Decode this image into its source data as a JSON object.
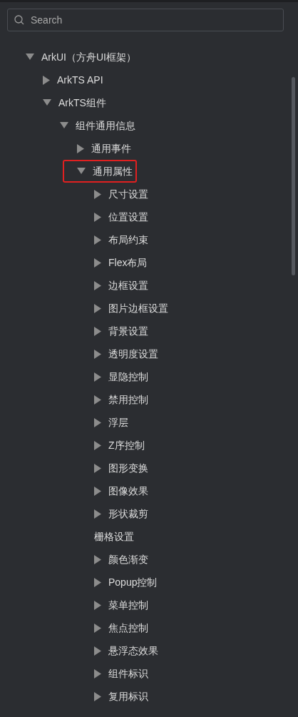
{
  "search": {
    "placeholder": "Search"
  },
  "tree": [
    {
      "label": "ArkUI（方舟UI框架）",
      "expanded": true,
      "children": [
        {
          "label": "ArkTS API",
          "expanded": false
        },
        {
          "label": "ArkTS组件",
          "expanded": true,
          "children": [
            {
              "label": "组件通用信息",
              "expanded": true,
              "children": [
                {
                  "label": "通用事件",
                  "expanded": false
                },
                {
                  "label": "通用属性",
                  "expanded": true,
                  "highlighted": true,
                  "children": [
                    {
                      "label": "尺寸设置",
                      "expanded": false
                    },
                    {
                      "label": "位置设置",
                      "expanded": false
                    },
                    {
                      "label": "布局约束",
                      "expanded": false
                    },
                    {
                      "label": "Flex布局",
                      "expanded": false
                    },
                    {
                      "label": "边框设置",
                      "expanded": false
                    },
                    {
                      "label": "图片边框设置",
                      "expanded": false
                    },
                    {
                      "label": "背景设置",
                      "expanded": false
                    },
                    {
                      "label": "透明度设置",
                      "expanded": false
                    },
                    {
                      "label": "显隐控制",
                      "expanded": false
                    },
                    {
                      "label": "禁用控制",
                      "expanded": false
                    },
                    {
                      "label": "浮层",
                      "expanded": false
                    },
                    {
                      "label": "Z序控制",
                      "expanded": false
                    },
                    {
                      "label": "图形变换",
                      "expanded": false
                    },
                    {
                      "label": "图像效果",
                      "expanded": false
                    },
                    {
                      "label": "形状裁剪",
                      "expanded": false
                    },
                    {
                      "label": "栅格设置"
                    },
                    {
                      "label": "颜色渐变",
                      "expanded": false
                    },
                    {
                      "label": "Popup控制",
                      "expanded": false
                    },
                    {
                      "label": "菜单控制",
                      "expanded": false
                    },
                    {
                      "label": "焦点控制",
                      "expanded": false
                    },
                    {
                      "label": "悬浮态效果",
                      "expanded": false
                    },
                    {
                      "label": "组件标识",
                      "expanded": false
                    },
                    {
                      "label": "复用标识",
                      "expanded": false
                    }
                  ]
                }
              ]
            }
          ]
        }
      ]
    }
  ]
}
